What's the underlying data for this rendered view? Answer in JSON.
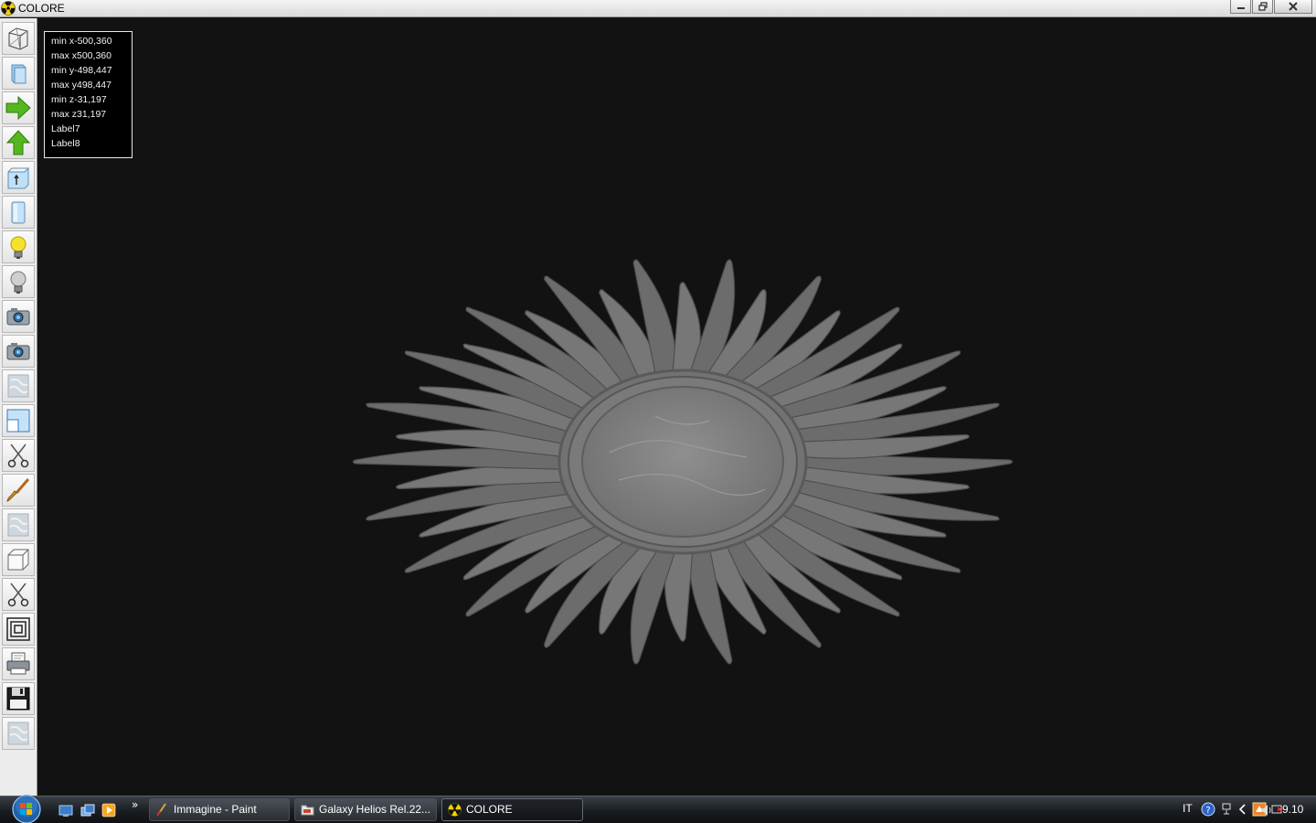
{
  "window": {
    "title": "COLORE"
  },
  "toolbar": {
    "tools": [
      {
        "icon": "wireframe-cube-icon"
      },
      {
        "icon": "solid-block-icon"
      },
      {
        "icon": "arrow-right-icon",
        "color": "#55b71f"
      },
      {
        "icon": "arrow-up-icon",
        "color": "#55b71f"
      },
      {
        "icon": "box-arrow-up-icon"
      },
      {
        "icon": "cylinder-icon"
      },
      {
        "icon": "light-bulb-on-icon",
        "color": "#f4e22c"
      },
      {
        "icon": "light-bulb-off-icon"
      },
      {
        "icon": "camera-icon"
      },
      {
        "icon": "camera-icon"
      },
      {
        "icon": "texture-icon"
      },
      {
        "icon": "window-split-icon"
      },
      {
        "icon": "scissors-icon"
      },
      {
        "icon": "paint-brush-icon"
      },
      {
        "icon": "texture-icon"
      },
      {
        "icon": "cube-icon"
      },
      {
        "icon": "scissors-icon"
      },
      {
        "icon": "nested-squares-icon"
      },
      {
        "icon": "printer-icon"
      },
      {
        "icon": "floppy-disk-icon"
      },
      {
        "icon": "texture-icon"
      }
    ]
  },
  "bounds": {
    "min_x": "min x-500,360",
    "max_x": "max x500,360",
    "min_y": "min y-498,447",
    "max_y": "max y498,447",
    "min_z": "min z-31,197",
    "max_z": "max z31,197",
    "label7": "Label7",
    "label8": "Label8"
  },
  "taskbar": {
    "tasks": [
      {
        "label": "Immagine - Paint",
        "icon": "paint-icon"
      },
      {
        "label": "Galaxy Helios  Rel.22...",
        "icon": "folder-icon"
      },
      {
        "label": "COLORE",
        "icon": "radiation-icon",
        "active": true
      }
    ],
    "tray": {
      "language": "IT",
      "time": "9.10"
    }
  }
}
